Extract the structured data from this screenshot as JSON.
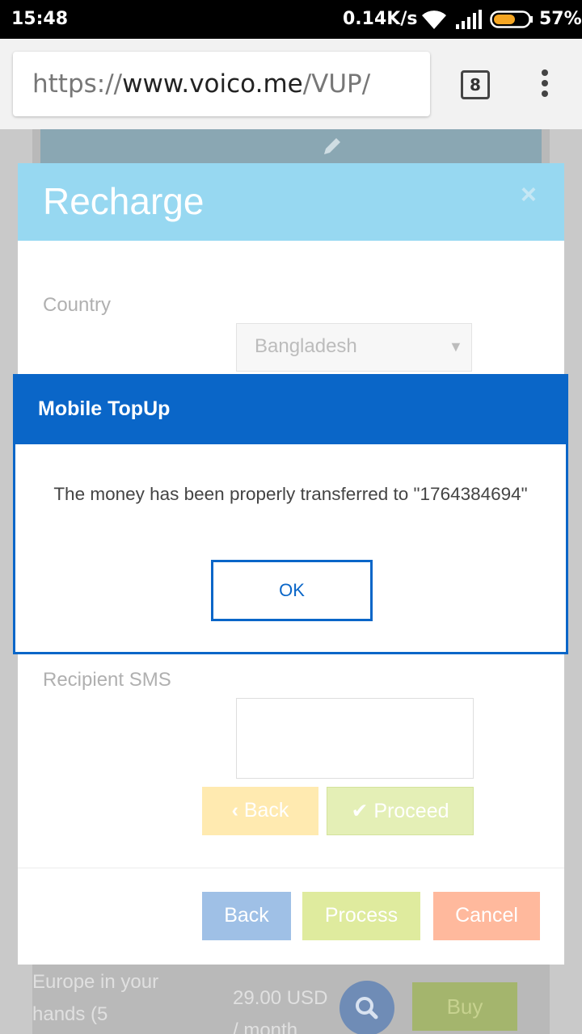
{
  "status_bar": {
    "time": "15:48",
    "net_speed": "0.14K/s",
    "battery": "57%"
  },
  "browser": {
    "url_scheme": "https://",
    "url_host": "www.voico.me",
    "url_path": "/VUP/",
    "tab_count": "8"
  },
  "background_page": {
    "plan_text": "Europe in your hands (5",
    "price": "29.00 USD / month",
    "buy_label": "Buy"
  },
  "recharge": {
    "title": "Recharge",
    "close": "×",
    "country_label": "Country",
    "country_value": "Bangladesh",
    "sms_label": "Recipient SMS",
    "back_label": "Back",
    "proceed_label": "Proceed",
    "footer_back": "Back",
    "footer_process": "Process",
    "footer_cancel": "Cancel"
  },
  "dialog": {
    "title": "Mobile TopUp",
    "message": "The money has been properly transferred to \"1764384694\"",
    "ok_label": "OK"
  },
  "colors": {
    "dialog_accent": "#0a66c8",
    "recharge_header": "#97d8f1"
  }
}
